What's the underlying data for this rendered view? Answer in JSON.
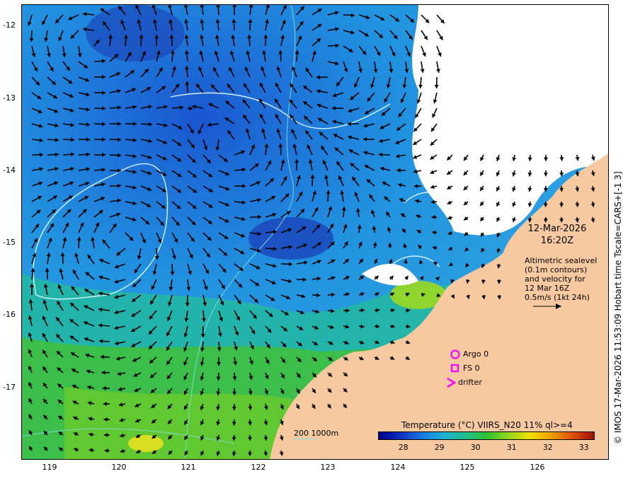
{
  "map": {
    "y_ticks": [
      "-12",
      "-13",
      "-14",
      "-15",
      "-16",
      "-17"
    ],
    "x_ticks": [
      "119",
      "120",
      "121",
      "122",
      "123",
      "124",
      "125",
      "126"
    ],
    "lon_range": [
      118.6,
      127.0
    ],
    "lat_range": [
      -17.95,
      -11.7
    ],
    "datetime_line1": "12-Mar-2026",
    "datetime_line2": "16:20Z",
    "altimetry_note": [
      "Altimetric sealevel",
      "(0.1m contours)",
      "and velocity for",
      "12 Mar 16Z",
      "0.5m/s (1kt 24h)"
    ],
    "side_credit": "© IMOS 17-Mar-2026 11:53:09 Hobart time Tscale=CARS+[-1 3]",
    "markers": {
      "argo_label": "Argo 0",
      "fs_label": "FS 0",
      "drifter_label": "drifter",
      "color": "#ff00ff"
    },
    "scale_note": "200  1000m",
    "colors": {
      "land": "#f7c9a0",
      "cloud": "#ffffff",
      "contour": "#e8ffff",
      "isobath": "#7fe0e0"
    }
  },
  "colorbar": {
    "title": "Temperature (°C) VIIRS_N20 11% ql>=4",
    "ticks": [
      "28",
      "29",
      "30",
      "31",
      "32",
      "33"
    ],
    "tick_values": [
      28,
      29,
      30,
      31,
      32,
      33
    ],
    "range": [
      27.3,
      33.3
    ]
  }
}
